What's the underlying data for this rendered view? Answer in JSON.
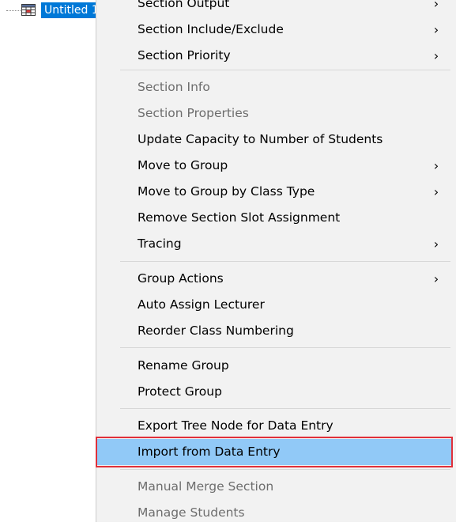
{
  "tree": {
    "node_label": "Untitled 1",
    "node_icon": "table-icon",
    "selection_color": "#0078d7"
  },
  "context_menu": {
    "items": [
      {
        "label": "Section Output",
        "submenu": true,
        "enabled": true
      },
      {
        "label": "Section Include/Exclude",
        "submenu": true,
        "enabled": true
      },
      {
        "label": "Section Priority",
        "submenu": true,
        "enabled": true
      },
      {
        "label": "Section Info",
        "submenu": false,
        "enabled": false
      },
      {
        "label": "Section Properties",
        "submenu": false,
        "enabled": false
      },
      {
        "label": "Update Capacity to Number of Students",
        "submenu": false,
        "enabled": true
      },
      {
        "label": "Move to Group",
        "submenu": true,
        "enabled": true
      },
      {
        "label": "Move to Group by Class Type",
        "submenu": true,
        "enabled": true
      },
      {
        "label": "Remove Section Slot Assignment",
        "submenu": false,
        "enabled": true
      },
      {
        "label": "Tracing",
        "submenu": true,
        "enabled": true
      },
      {
        "label": "Group Actions",
        "submenu": true,
        "enabled": true
      },
      {
        "label": "Auto Assign Lecturer",
        "submenu": false,
        "enabled": true
      },
      {
        "label": "Reorder Class Numbering",
        "submenu": false,
        "enabled": true
      },
      {
        "label": "Rename Group",
        "submenu": false,
        "enabled": true
      },
      {
        "label": "Protect Group",
        "submenu": false,
        "enabled": true
      },
      {
        "label": "Export Tree Node for Data Entry",
        "submenu": false,
        "enabled": true
      },
      {
        "label": "Import from Data Entry",
        "submenu": false,
        "enabled": true,
        "highlighted": true
      },
      {
        "label": "Manual Merge Section",
        "submenu": false,
        "enabled": false
      },
      {
        "label": "Manage Students",
        "submenu": false,
        "enabled": false
      }
    ],
    "submenu_arrow": "›",
    "highlight_color": "#91c9f7",
    "annotation_color": "#e0303a"
  }
}
